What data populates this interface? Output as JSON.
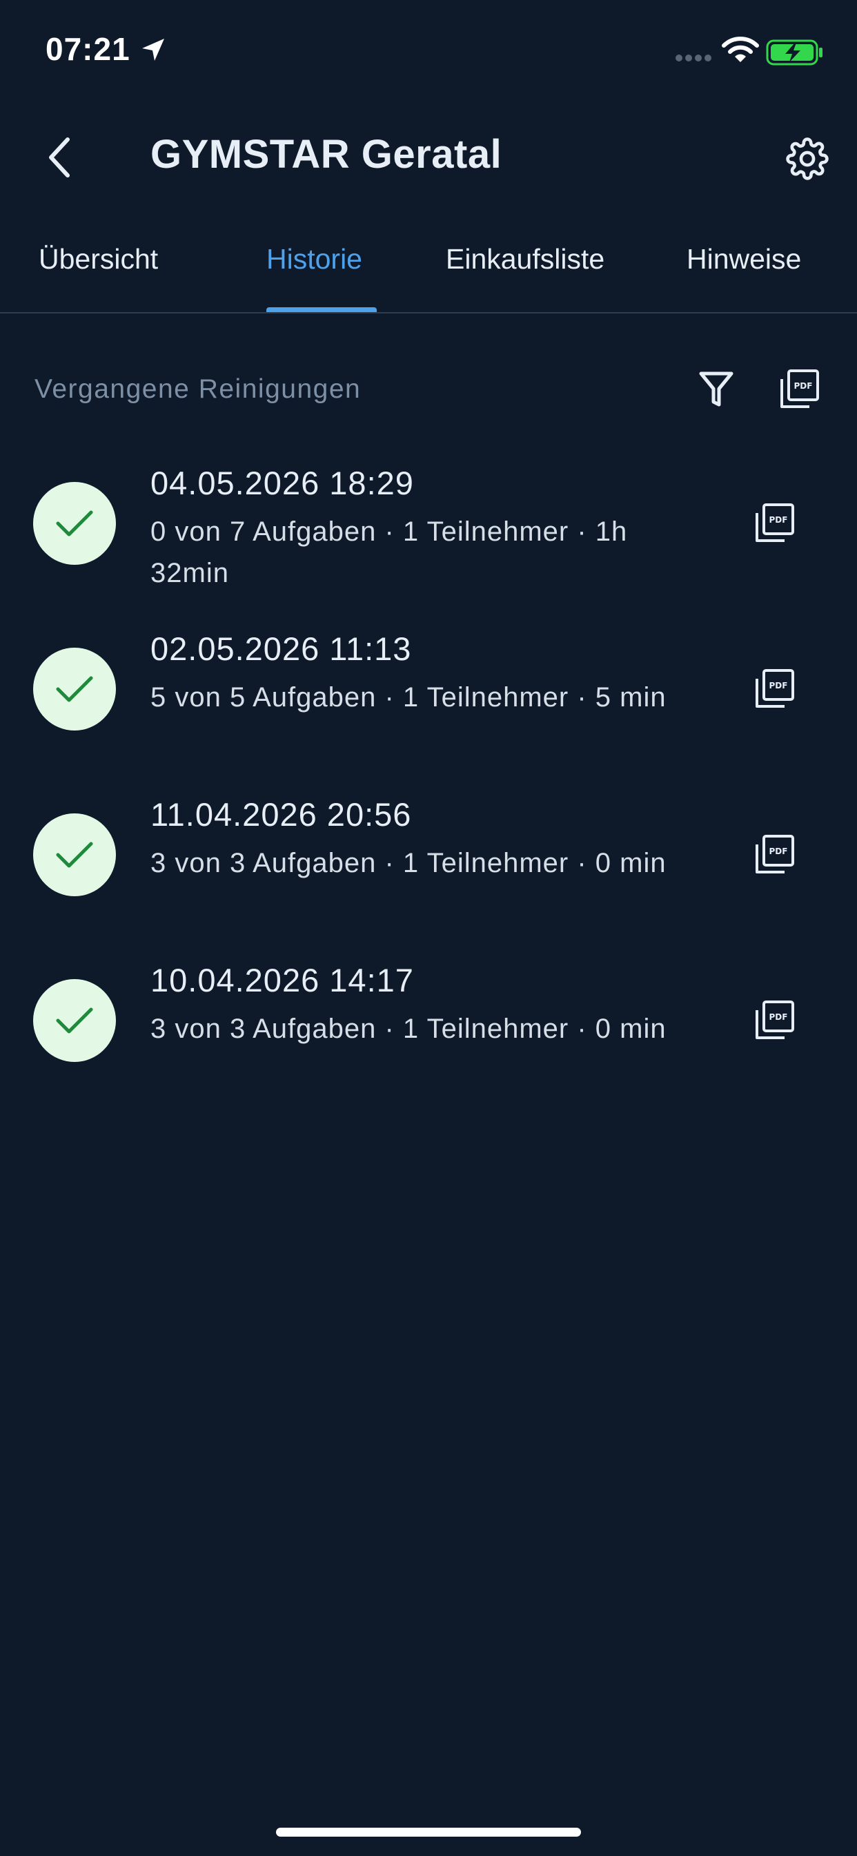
{
  "status_bar": {
    "time": "07:21",
    "location_icon": "location-arrow-icon",
    "wifi_icon": "wifi-icon",
    "battery_icon": "battery-charging-icon",
    "battery_color": "#32d74b"
  },
  "header": {
    "title": "GYMSTAR Geratal",
    "back_icon": "chevron-left-icon",
    "settings_icon": "gear-icon"
  },
  "tabs": [
    {
      "label": "Übersicht",
      "active": false
    },
    {
      "label": "Historie",
      "active": true
    },
    {
      "label": "Einkaufsliste",
      "active": false
    },
    {
      "label": "Hinweise",
      "active": false
    }
  ],
  "section": {
    "title": "Vergangene Reinigungen",
    "filter_icon": "filter-icon",
    "pdf_icon": "pdf-icon"
  },
  "history": [
    {
      "date": "04.05.2026 18:29",
      "details": "0 von 7 Aufgaben · 1 Teilnehmer · 1h 32min",
      "status_icon": "checkmark-icon"
    },
    {
      "date": "02.05.2026 11:13",
      "details": "5 von 5 Aufgaben · 1 Teilnehmer · 5 min",
      "status_icon": "checkmark-icon"
    },
    {
      "date": "11.04.2026 20:56",
      "details": "3 von 3 Aufgaben · 1 Teilnehmer · 0 min",
      "status_icon": "checkmark-icon"
    },
    {
      "date": "10.04.2026 14:17",
      "details": "3 von 3 Aufgaben · 1 Teilnehmer · 0 min",
      "status_icon": "checkmark-icon"
    }
  ],
  "colors": {
    "background": "#0e1929",
    "accent": "#4ea2ec",
    "success_bg": "#e3f9e6",
    "success_check": "#1f8a3c",
    "muted_text": "#7e90a6"
  }
}
